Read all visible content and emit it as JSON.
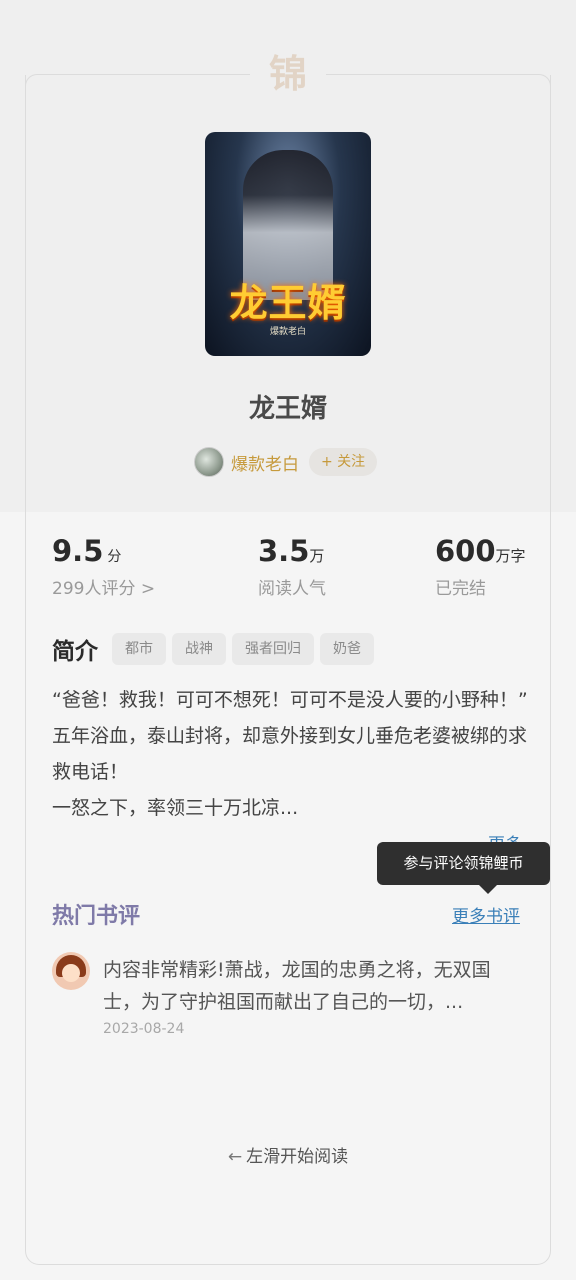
{
  "decor": {
    "mark": "锦"
  },
  "book": {
    "title": "龙王婿",
    "cover_title": "龙王婿",
    "cover_author": "爆款老白",
    "author": "爆款老白",
    "follow_label": "+ 关注"
  },
  "stats": {
    "score": "9.5",
    "score_unit": "分",
    "score_sub": "299人评分 >",
    "popularity": "3.5",
    "popularity_unit": "万",
    "popularity_sub": "阅读人气",
    "words": "600",
    "words_unit": "万字",
    "words_sub": "已完结"
  },
  "intro": {
    "title": "简介",
    "tags": [
      "都市",
      "战神",
      "强者回归",
      "奶爸"
    ],
    "text": "“爸爸！救我！可可不想死！可可不是没人要的小野种！”\n五年浴血，泰山封将，却意外接到女儿垂危老婆被绑的求救电话！\n一怒之下，率领三十万北凉...",
    "more": "更多"
  },
  "tooltip": "参与评论领锦鲤币",
  "reviews": {
    "title": "热门书评",
    "more": "更多书评",
    "items": [
      {
        "text": "内容非常精彩!萧战，龙国的忠勇之将，无双国士，为了守护祖国而献出了自己的一切，...",
        "date": "2023-08-24"
      }
    ]
  },
  "swipe_hint": "左滑开始阅读"
}
